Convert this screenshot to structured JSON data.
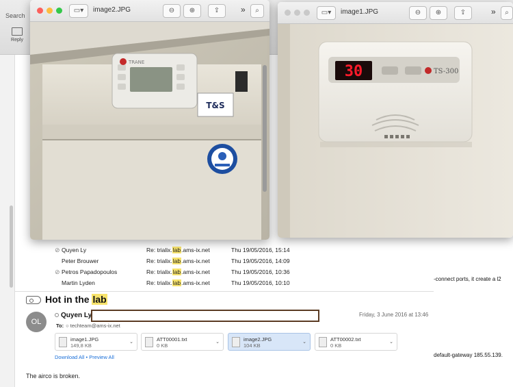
{
  "toolbar": {
    "search_label": "Search",
    "reply_label": "Reply"
  },
  "messages": [
    {
      "attachment": true,
      "from": "Quyen Ly",
      "subject_pre": "Re: trialix.",
      "subject_hl": "lab",
      "subject_post": ".ams-ix.net",
      "date": "Thu 19/05/2016, 15:14"
    },
    {
      "attachment": false,
      "from": "Peter Brouwer",
      "subject_pre": "Re: trialix.",
      "subject_hl": "lab",
      "subject_post": ".ams-ix.net",
      "date": "Thu 19/05/2016, 14:09"
    },
    {
      "attachment": true,
      "from": "Petros Papadopoulos",
      "subject_pre": "Re: trialix.",
      "subject_hl": "lab",
      "subject_post": ".ams-ix.net",
      "date": "Thu 19/05/2016, 10:36"
    },
    {
      "attachment": false,
      "from": "Martin Lyden",
      "subject_pre": "Re: trialix.",
      "subject_hl": "lab",
      "subject_post": ".ams-ix.net",
      "date": "Thu 19/05/2016, 10:10"
    }
  ],
  "right_snippets": {
    "connect": "-connect ports, it create a l2",
    "gateway": "default-gateway 185.55.139."
  },
  "viewer": {
    "subject_pre": "Hot in the ",
    "subject_hl": "lab",
    "avatar_initials": "OL",
    "sender": "Quyen Ly",
    "date": "Friday, 3 June 2016 at 13:46",
    "to_label": "To:",
    "to_address": "techteam@ams-ix.net",
    "attachments": [
      {
        "name": "image1.JPG",
        "size": "149,8 KB",
        "selected": false
      },
      {
        "name": "ATT00001.txt",
        "size": "0 KB",
        "selected": false
      },
      {
        "name": "image2.JPG",
        "size": "104 KB",
        "selected": true
      },
      {
        "name": "ATT00002.txt",
        "size": "0 KB",
        "selected": false
      }
    ],
    "download_all": "Download All",
    "preview_all": "Preview All",
    "link_separator": "•",
    "body": "The airco is broken."
  },
  "quicklook_left": {
    "title": "image2.JPG",
    "photo_sticker": "T&S",
    "photo_brand": "TRANE"
  },
  "quicklook_right": {
    "title": "image1.JPG",
    "thermostat_reading": "30",
    "thermostat_model": "TS-300"
  },
  "colors": {
    "highlight": "#f7e36b",
    "link": "#1a6fd8",
    "redact_border": "#5a3a22",
    "led": "#ff1a2a",
    "traffic_red": "#fc605c",
    "traffic_yellow": "#fdbc40",
    "traffic_green": "#34c84a"
  }
}
